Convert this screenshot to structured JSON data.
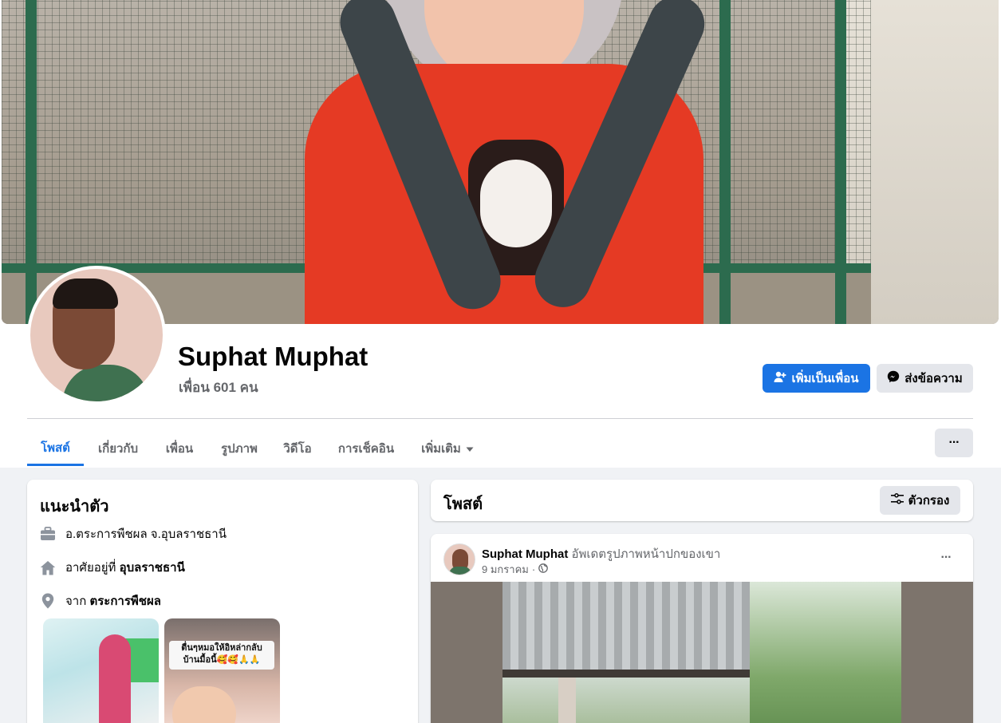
{
  "profile": {
    "name": "Suphat Muphat",
    "friends_count": "เพื่อน 601 คน"
  },
  "actions": {
    "add_friend": "เพิ่มเป็นเพื่อน",
    "message": "ส่งข้อความ",
    "more": "···"
  },
  "tabs": [
    {
      "label": "โพสต์",
      "active": true
    },
    {
      "label": "เกี่ยวกับ"
    },
    {
      "label": "เพื่อน"
    },
    {
      "label": "รูปภาพ"
    },
    {
      "label": "วิดีโอ"
    },
    {
      "label": "การเช็คอิน"
    },
    {
      "label": "เพิ่มเติม"
    }
  ],
  "intro": {
    "title": "แนะนำตัว",
    "work": "อ.ตระการพืชผล จ.อุบลราชธานี",
    "lives_prefix": "อาศัยอยู่ที่",
    "lives_place": "อุบลราชธานี",
    "from_prefix": "จาก",
    "from_place": "ตระการพืชผล",
    "photo2_caption_line1": "ตื่นๆหมอให้อิหล่ากลับ",
    "photo2_caption_line2": "บ้านมื้อนี้🥰🥰🙏🙏"
  },
  "posts_header": {
    "title": "โพสต์",
    "filter": "ตัวกรอง"
  },
  "post": {
    "author": "Suphat Muphat",
    "action": "อัพเดตรูปภาพหน้าปกของเขา",
    "date": "9 มกราคม",
    "separator": "·",
    "more": "···"
  },
  "colors": {
    "primary": "#1b74e4",
    "secondary_text": "#65676b",
    "gray_button": "#e4e6eb"
  },
  "icons": [
    "user-plus-icon",
    "messenger-icon",
    "caret-down-icon",
    "filter-icon",
    "briefcase-icon",
    "home-icon",
    "location-pin-icon",
    "globe-icon"
  ]
}
